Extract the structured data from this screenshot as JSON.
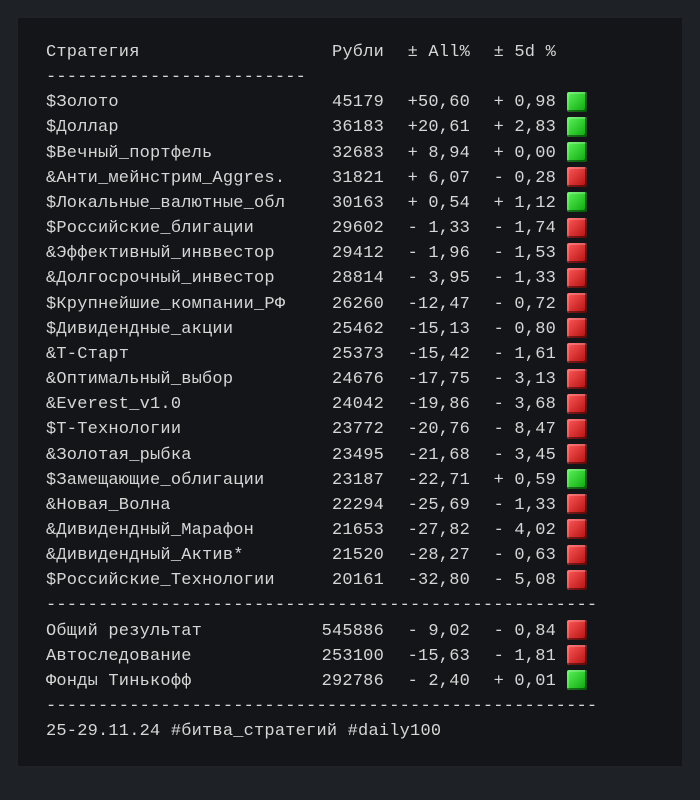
{
  "chart_data": {
    "type": "table",
    "title": "",
    "columns": [
      "Стратегия",
      "Рубли",
      "± All%",
      "± 5d %"
    ],
    "rows": [
      {
        "strategy": "$Золото",
        "rub": 45179,
        "all_pct": 50.6,
        "d5_pct": 0.98,
        "status": "green"
      },
      {
        "strategy": "$Доллар",
        "rub": 36183,
        "all_pct": 20.61,
        "d5_pct": 2.83,
        "status": "green"
      },
      {
        "strategy": "$Вечный_портфель",
        "rub": 32683,
        "all_pct": 8.94,
        "d5_pct": 0.0,
        "status": "green"
      },
      {
        "strategy": "&Анти_мейнстрим_Aggres.",
        "rub": 31821,
        "all_pct": 6.07,
        "d5_pct": -0.28,
        "status": "red"
      },
      {
        "strategy": "$Локальные_валютные_обл",
        "rub": 30163,
        "all_pct": 0.54,
        "d5_pct": 1.12,
        "status": "green"
      },
      {
        "strategy": "$Российские_блигации",
        "rub": 29602,
        "all_pct": -1.33,
        "d5_pct": -1.74,
        "status": "red"
      },
      {
        "strategy": "&Эффективный_инввестор",
        "rub": 29412,
        "all_pct": -1.96,
        "d5_pct": -1.53,
        "status": "red"
      },
      {
        "strategy": "&Долгосрочный_инвестор",
        "rub": 28814,
        "all_pct": -3.95,
        "d5_pct": -1.33,
        "status": "red"
      },
      {
        "strategy": "$Крупнейшие_компании_РФ",
        "rub": 26260,
        "all_pct": -12.47,
        "d5_pct": -0.72,
        "status": "red"
      },
      {
        "strategy": "$Дивидендные_акции",
        "rub": 25462,
        "all_pct": -15.13,
        "d5_pct": -0.8,
        "status": "red"
      },
      {
        "strategy": "&Т-Старт",
        "rub": 25373,
        "all_pct": -15.42,
        "d5_pct": -1.61,
        "status": "red"
      },
      {
        "strategy": "&Оптимальный_выбор",
        "rub": 24676,
        "all_pct": -17.75,
        "d5_pct": -3.13,
        "status": "red"
      },
      {
        "strategy": "&Everest_v1.0",
        "rub": 24042,
        "all_pct": -19.86,
        "d5_pct": -3.68,
        "status": "red"
      },
      {
        "strategy": "$Т-Технологии",
        "rub": 23772,
        "all_pct": -20.76,
        "d5_pct": -8.47,
        "status": "red"
      },
      {
        "strategy": "&Золотая_рыбка",
        "rub": 23495,
        "all_pct": -21.68,
        "d5_pct": -3.45,
        "status": "red"
      },
      {
        "strategy": "$Замещающие_облигации",
        "rub": 23187,
        "all_pct": -22.71,
        "d5_pct": 0.59,
        "status": "green"
      },
      {
        "strategy": "&Новая_Волна",
        "rub": 22294,
        "all_pct": -25.69,
        "d5_pct": -1.33,
        "status": "red"
      },
      {
        "strategy": "&Дивидендный_Марафон",
        "rub": 21653,
        "all_pct": -27.82,
        "d5_pct": -4.02,
        "status": "red"
      },
      {
        "strategy": "&Дивидендный_Актив*",
        "rub": 21520,
        "all_pct": -28.27,
        "d5_pct": -0.63,
        "status": "red"
      },
      {
        "strategy": "$Российские_Технологии",
        "rub": 20161,
        "all_pct": -32.8,
        "d5_pct": -5.08,
        "status": "red"
      }
    ],
    "summary": [
      {
        "label": "Общий результат",
        "rub": 545886,
        "all_pct": -9.02,
        "d5_pct": -0.84,
        "status": "red"
      },
      {
        "label": "Автоследование",
        "rub": 253100,
        "all_pct": -15.63,
        "d5_pct": -1.81,
        "status": "red"
      },
      {
        "label": "Фонды Тинькофф",
        "rub": 292786,
        "all_pct": -2.4,
        "d5_pct": 0.01,
        "status": "green"
      }
    ],
    "footer": "25-29.11.24 #битва_стратегий #daily100"
  },
  "header": {
    "strategy": "Стратегия",
    "rub": "Рубли",
    "all": "± All%",
    "d5": "± 5d %"
  },
  "divider_short": "-------------------------",
  "divider_long": "-----------------------------------------------------"
}
